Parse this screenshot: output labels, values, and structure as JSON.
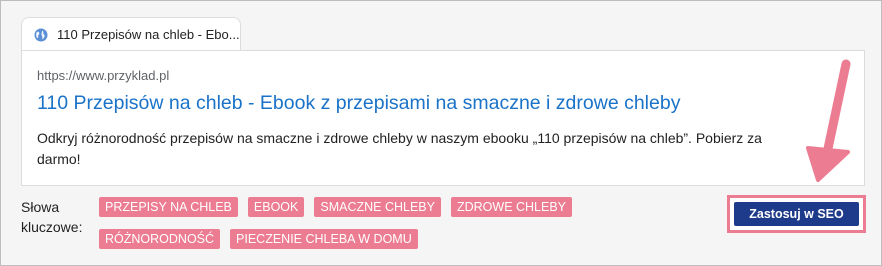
{
  "tab": {
    "icon": "globe-icon",
    "title": "110 Przepisów na chleb - Ebo..."
  },
  "preview": {
    "url": "https://www.przyklad.pl",
    "title": "110 Przepisów na chleb - Ebook z przepisami na smaczne i zdrowe chleby",
    "description": "Odkryj różnorodność przepisów na smaczne i zdrowe chleby w naszym ebooku „110 przepisów na chleb”. Pobierz za darmo!"
  },
  "keywords": {
    "label": "Słowa kluczowe:",
    "row1": [
      "PRZEPISY NA CHLEB",
      "EBOOK",
      "SMACZNE CHLEBY",
      "ZDROWE CHLEBY"
    ],
    "row2": [
      "RÓŻNORODNOŚĆ",
      "PIECZENIE CHLEBA W DOMU"
    ]
  },
  "apply_button": {
    "label": "Zastosuj w SEO"
  },
  "colors": {
    "accent_pink": "#ec7c91",
    "button_navy": "#1e3a8a",
    "link_blue": "#1a73c8"
  }
}
